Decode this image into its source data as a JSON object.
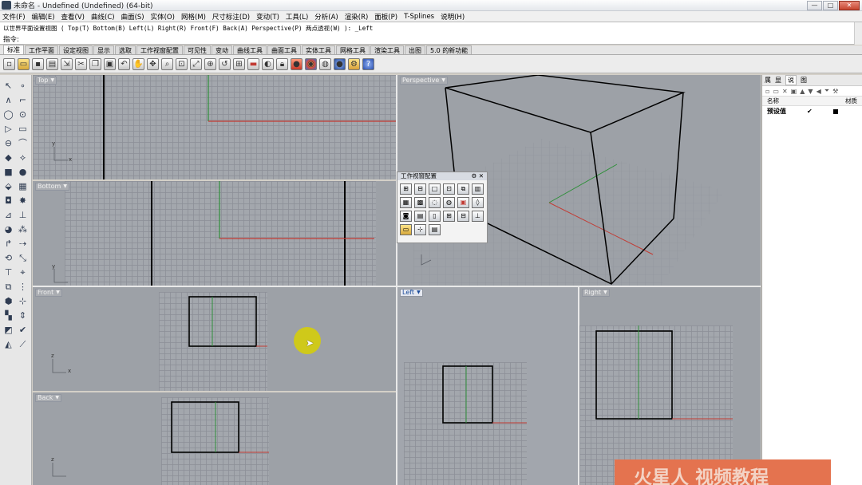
{
  "window": {
    "title": "未命名 - Undefined (Undefined) (64-bit)",
    "buttons": [
      "—",
      "□",
      "✕"
    ]
  },
  "menu": [
    "文件(F)",
    "编辑(E)",
    "查看(V)",
    "曲线(C)",
    "曲面(S)",
    "实体(O)",
    "网格(M)",
    "尺寸标注(D)",
    "变动(T)",
    "工具(L)",
    "分析(A)",
    "渲染(R)",
    "面板(P)",
    "T-Splines",
    "说明(H)"
  ],
  "command": {
    "history": "以世界平面设置视图 ( Top(T) Bottom(B) Left(L) Right(R) Front(F) Back(A) Perspective(P) 两点透视(W) ): _Left",
    "prompt_label": "指令:",
    "input_value": ""
  },
  "tabs": [
    "标准",
    "工作平面",
    "设定视图",
    "显示",
    "选取",
    "工作视窗配置",
    "可见性",
    "变动",
    "曲线工具",
    "曲面工具",
    "实体工具",
    "网格工具",
    "渲染工具",
    "出图",
    "5.0 的新功能"
  ],
  "active_tab": "标准",
  "toolbar_icons": [
    "new-icon",
    "open-icon",
    "save-icon",
    "print-icon",
    "import-icon",
    "cut-icon",
    "copy-icon",
    "paste-icon",
    "undo-icon",
    "pan-icon",
    "rotate-view-icon",
    "zoom-icon",
    "zoom-window-icon",
    "zoom-extents-icon",
    "zoom-selected-icon",
    "undo-view-icon",
    "four-view-icon",
    "layer-icon",
    "hide-icon",
    "lock-icon",
    "render-icon",
    "material-icon",
    "environment-icon",
    "sphere-icon",
    "options-icon",
    "help-icon"
  ],
  "viewports": {
    "top": "Top",
    "bottom": "Bottom",
    "front": "Front",
    "back": "Back",
    "perspective": "Perspective",
    "left": "Left",
    "right": "Right"
  },
  "axis": {
    "x": "x",
    "y": "y",
    "z": "z"
  },
  "float_window": {
    "title": "工作视窗配置",
    "buttons": "⚙ ✕"
  },
  "right_panel": {
    "tabs": [
      "属",
      "显",
      "说",
      "图"
    ],
    "columns": {
      "name": "名称",
      "material": "材质"
    },
    "row": {
      "name": "预设值",
      "check": "✔"
    }
  },
  "watermark": "火星人 视频教程",
  "colors": {
    "x_axis": "#c23b34",
    "y_axis": "#2f8f3a",
    "highlight": "#d4cc0e",
    "watermark": "#e4734f"
  }
}
